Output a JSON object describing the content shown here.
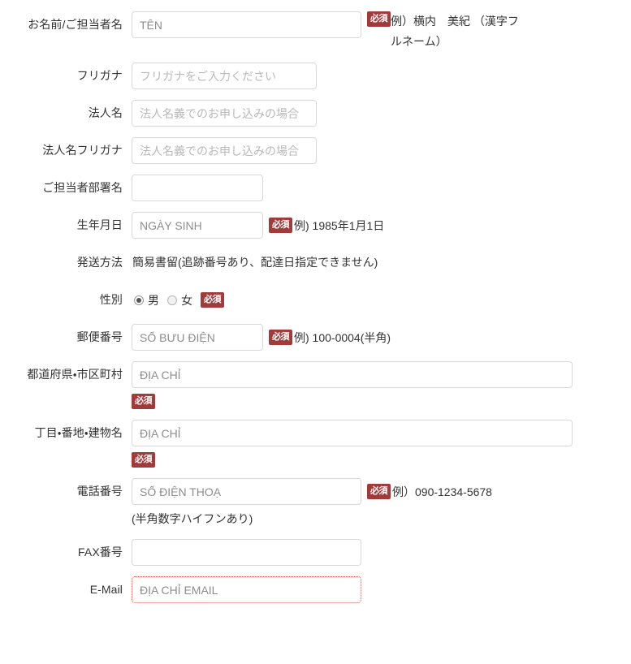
{
  "form": {
    "badge_label": "必須",
    "rows": [
      {
        "id": "name",
        "label": "お名前/ご担当者名",
        "input_value": "TÊN",
        "placeholder": "",
        "required": true,
        "example": "例）横内　美紀 （漢字フルネーム）"
      },
      {
        "id": "furigana",
        "label": "フリガナ",
        "input_value": "",
        "placeholder": "フリガナをご入力ください",
        "required": false,
        "example": ""
      },
      {
        "id": "corp-name",
        "label": "法人名",
        "input_value": "",
        "placeholder": "法人名義でのお申し込みの場合",
        "required": false,
        "example": ""
      },
      {
        "id": "corp-furigana",
        "label": "法人名フリガナ",
        "input_value": "",
        "placeholder": "法人名義でのお申し込みの場合",
        "required": false,
        "example": ""
      },
      {
        "id": "department",
        "label": "ご担当者部署名",
        "input_value": "",
        "placeholder": "",
        "required": false,
        "example": ""
      },
      {
        "id": "birthdate",
        "label": "生年月日",
        "input_value": "NGÀY SINH",
        "placeholder": "",
        "required": true,
        "example": "例) 1985年1月1日"
      },
      {
        "id": "shipping-method",
        "label": "発送方法",
        "static_value": "簡易書留(追跡番号あり、配達日指定できません)"
      },
      {
        "id": "gender",
        "label": "性別",
        "required": true,
        "options": [
          {
            "label": "男",
            "selected": true
          },
          {
            "label": "女",
            "selected": false
          }
        ]
      },
      {
        "id": "postal-code",
        "label": "郵便番号",
        "input_value": "SỐ BƯU ĐIỆN",
        "placeholder": "",
        "required": true,
        "example": "例) 100-0004(半角)"
      },
      {
        "id": "prefecture-city",
        "label": "都道府県・市区町村",
        "input_value": "ĐỊA CHỈ",
        "placeholder": "",
        "required": true,
        "badge_below": true,
        "example": ""
      },
      {
        "id": "street-building",
        "label": "丁目・番地・建物名",
        "input_value": "ĐỊA CHỈ",
        "placeholder": "",
        "required": true,
        "badge_below": true,
        "example": ""
      },
      {
        "id": "telephone",
        "label": "電話番号",
        "input_value": "SỐ ĐIỆN THOẠ",
        "placeholder": "",
        "required": true,
        "example": "例）090-1234-5678",
        "note": "(半角数字ハイフンあり)"
      },
      {
        "id": "fax",
        "label": "FAX番号",
        "input_value": "",
        "placeholder": "",
        "required": false,
        "example": ""
      },
      {
        "id": "email",
        "label": "E-Mail",
        "input_value": "ĐỊA CHỈ EMAIL",
        "placeholder": "",
        "required": false,
        "error": true,
        "example": ""
      }
    ]
  },
  "colors": {
    "badge_bg": "#a33a3a",
    "badge_text": "#ffffff",
    "error_border": "#e74c3c",
    "input_border": "#d8d8d8",
    "text": "#333333",
    "placeholder": "#b9b9b9"
  }
}
